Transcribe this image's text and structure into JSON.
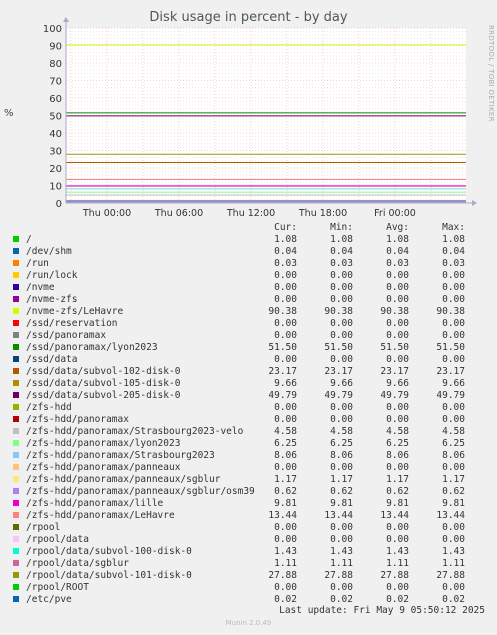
{
  "chart_data": {
    "type": "line",
    "title": "Disk usage in percent - by day",
    "side_label": "RRDTOOL / TOBI OETIKER",
    "ylabel": "%",
    "ylim": [
      0,
      100
    ],
    "yticks": [
      0,
      10,
      20,
      30,
      40,
      50,
      60,
      70,
      80,
      90,
      100
    ],
    "x_ticks": [
      "Thu 00:00",
      "Thu 06:00",
      "Thu 12:00",
      "Thu 18:00",
      "Fri 00:00"
    ],
    "columns": [
      "Cur:",
      "Min:",
      "Avg:",
      "Max:"
    ],
    "series": [
      {
        "name": "/",
        "color": "#00cc00",
        "cur": "1.08",
        "min": "1.08",
        "avg": "1.08",
        "max": "1.08"
      },
      {
        "name": "/dev/shm",
        "color": "#0066b3",
        "cur": "0.04",
        "min": "0.04",
        "avg": "0.04",
        "max": "0.04"
      },
      {
        "name": "/run",
        "color": "#ff8000",
        "cur": "0.03",
        "min": "0.03",
        "avg": "0.03",
        "max": "0.03"
      },
      {
        "name": "/run/lock",
        "color": "#ffcc00",
        "cur": "0.00",
        "min": "0.00",
        "avg": "0.00",
        "max": "0.00"
      },
      {
        "name": "/nvme",
        "color": "#330099",
        "cur": "0.00",
        "min": "0.00",
        "avg": "0.00",
        "max": "0.00"
      },
      {
        "name": "/nvme-zfs",
        "color": "#990099",
        "cur": "0.00",
        "min": "0.00",
        "avg": "0.00",
        "max": "0.00"
      },
      {
        "name": "/nvme-zfs/LeHavre",
        "color": "#ccff00",
        "cur": "90.38",
        "min": "90.38",
        "avg": "90.38",
        "max": "90.38"
      },
      {
        "name": "/ssd/reservation",
        "color": "#ff0000",
        "cur": "0.00",
        "min": "0.00",
        "avg": "0.00",
        "max": "0.00"
      },
      {
        "name": "/ssd/panoramax",
        "color": "#808080",
        "cur": "0.00",
        "min": "0.00",
        "avg": "0.00",
        "max": "0.00"
      },
      {
        "name": "/ssd/panoramax/lyon2023",
        "color": "#008f00",
        "cur": "51.50",
        "min": "51.50",
        "avg": "51.50",
        "max": "51.50"
      },
      {
        "name": "/ssd/data",
        "color": "#00487d",
        "cur": "0.00",
        "min": "0.00",
        "avg": "0.00",
        "max": "0.00"
      },
      {
        "name": "/ssd/data/subvol-102-disk-0",
        "color": "#b35a00",
        "cur": "23.17",
        "min": "23.17",
        "avg": "23.17",
        "max": "23.17"
      },
      {
        "name": "/ssd/data/subvol-105-disk-0",
        "color": "#b38f00",
        "cur": "9.66",
        "min": "9.66",
        "avg": "9.66",
        "max": "9.66"
      },
      {
        "name": "/ssd/data/subvol-205-disk-0",
        "color": "#6b006b",
        "cur": "49.79",
        "min": "49.79",
        "avg": "49.79",
        "max": "49.79"
      },
      {
        "name": "/zfs-hdd",
        "color": "#8fb300",
        "cur": "0.00",
        "min": "0.00",
        "avg": "0.00",
        "max": "0.00"
      },
      {
        "name": "/zfs-hdd/panoramax",
        "color": "#b30000",
        "cur": "0.00",
        "min": "0.00",
        "avg": "0.00",
        "max": "0.00"
      },
      {
        "name": "/zfs-hdd/panoramax/Strasbourg2023-velo",
        "color": "#bebebe",
        "cur": "4.58",
        "min": "4.58",
        "avg": "4.58",
        "max": "4.58"
      },
      {
        "name": "/zfs-hdd/panoramax/lyon2023",
        "color": "#80ff80",
        "cur": "6.25",
        "min": "6.25",
        "avg": "6.25",
        "max": "6.25"
      },
      {
        "name": "/zfs-hdd/panoramax/Strasbourg2023",
        "color": "#80c9ff",
        "cur": "8.06",
        "min": "8.06",
        "avg": "8.06",
        "max": "8.06"
      },
      {
        "name": "/zfs-hdd/panoramax/panneaux",
        "color": "#ffc080",
        "cur": "0.00",
        "min": "0.00",
        "avg": "0.00",
        "max": "0.00"
      },
      {
        "name": "/zfs-hdd/panoramax/panneaux/sgblur",
        "color": "#ffe680",
        "cur": "1.17",
        "min": "1.17",
        "avg": "1.17",
        "max": "1.17"
      },
      {
        "name": "/zfs-hdd/panoramax/panneaux/sgblur/osm39",
        "color": "#aa80ff",
        "cur": "0.62",
        "min": "0.62",
        "avg": "0.62",
        "max": "0.62"
      },
      {
        "name": "/zfs-hdd/panoramax/lille",
        "color": "#ee00cc",
        "cur": "9.81",
        "min": "9.81",
        "avg": "9.81",
        "max": "9.81"
      },
      {
        "name": "/zfs-hdd/panoramax/LeHavre",
        "color": "#ff8080",
        "cur": "13.44",
        "min": "13.44",
        "avg": "13.44",
        "max": "13.44"
      },
      {
        "name": "/rpool",
        "color": "#666600",
        "cur": "0.00",
        "min": "0.00",
        "avg": "0.00",
        "max": "0.00"
      },
      {
        "name": "/rpool/data",
        "color": "#ffbfff",
        "cur": "0.00",
        "min": "0.00",
        "avg": "0.00",
        "max": "0.00"
      },
      {
        "name": "/rpool/data/subvol-100-disk-0",
        "color": "#00ffcc",
        "cur": "1.43",
        "min": "1.43",
        "avg": "1.43",
        "max": "1.43"
      },
      {
        "name": "/rpool/data/sgblur",
        "color": "#cc6699",
        "cur": "1.11",
        "min": "1.11",
        "avg": "1.11",
        "max": "1.11"
      },
      {
        "name": "/rpool/data/subvol-101-disk-0",
        "color": "#999900",
        "cur": "27.88",
        "min": "27.88",
        "avg": "27.88",
        "max": "27.88"
      },
      {
        "name": "/rpool/ROOT",
        "color": "#00cc00",
        "cur": "0.00",
        "min": "0.00",
        "avg": "0.00",
        "max": "0.00"
      },
      {
        "name": "/etc/pve",
        "color": "#0066b3",
        "cur": "0.02",
        "min": "0.02",
        "avg": "0.02",
        "max": "0.02"
      }
    ]
  },
  "footer": {
    "last_update": "Last update: Fri May  9 05:50:12 2025",
    "munin": "Munin 2.0.49"
  }
}
